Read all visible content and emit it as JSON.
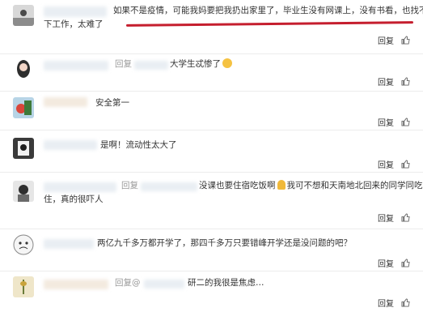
{
  "comments": [
    {
      "line1": "如果不是疫情，可能我妈要把我扔出家里了，毕业生没有网课上，没有书看，也找不",
      "line2": "下工作，太难了",
      "reply": "回复"
    },
    {
      "prefix": "回复",
      "text": "大学生忒惨了",
      "reply": "回复"
    },
    {
      "text": "安全第一",
      "reply": "回复"
    },
    {
      "text": "是啊！流动性太大了",
      "reply": "回复"
    },
    {
      "prefix": "回复",
      "line1": "没课也要住宿吃饭啊",
      "line1b": "我可不想和天南地北回来的同学同吃同",
      "line2": "住，真的很吓人",
      "reply": "回复"
    },
    {
      "text": "两亿九千多万都开学了，那四千多万只要错峰开学还是没问题的吧？",
      "reply": "回复"
    },
    {
      "prefix": "回复",
      "at": "@",
      "text": "研二的我很是焦虑…",
      "reply": "回复"
    }
  ]
}
